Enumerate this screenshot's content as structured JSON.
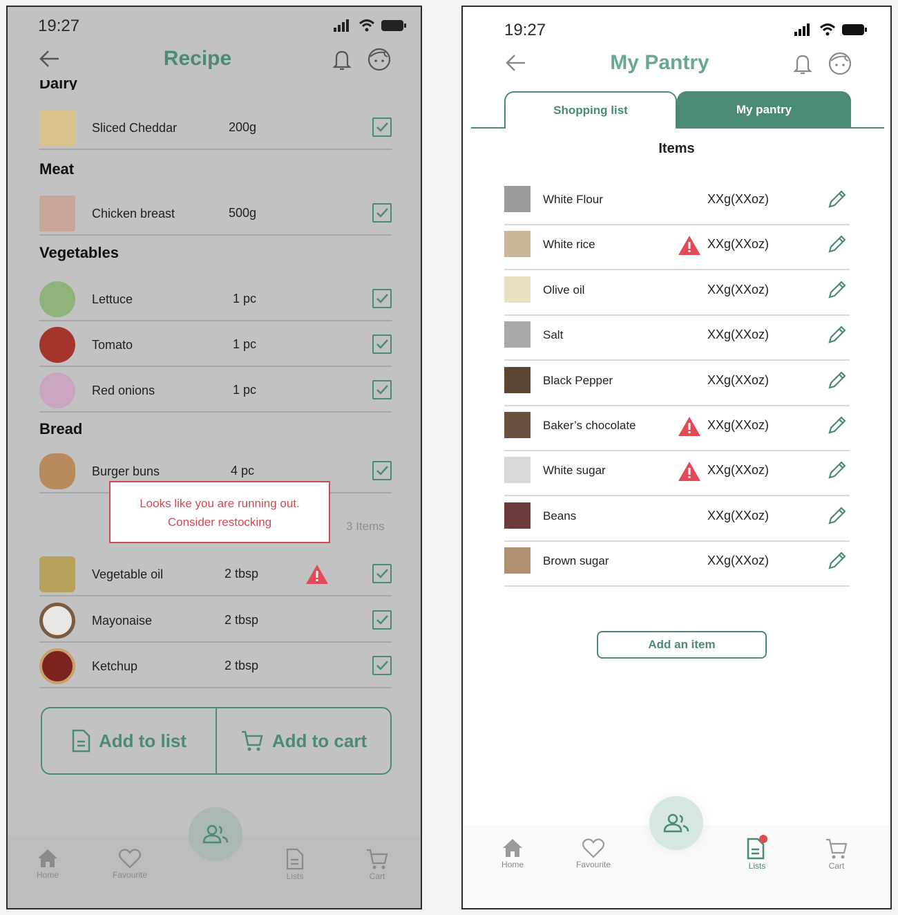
{
  "left": {
    "status": {
      "time": "19:27"
    },
    "header": {
      "title": "Recipe"
    },
    "partial_category": "Dairy",
    "categories": {
      "meat": "Meat",
      "vegetables": "Vegetables",
      "bread": "Bread"
    },
    "ingredients": [
      {
        "name": "Sliced Cheddar",
        "qty": "200g"
      },
      {
        "name": "Chicken breast",
        "qty": "500g"
      },
      {
        "name": "Lettuce",
        "qty": "1 pc"
      },
      {
        "name": "Tomato",
        "qty": "1 pc"
      },
      {
        "name": "Red onions",
        "qty": "1 pc"
      },
      {
        "name": "Burger buns",
        "qty": "4 pc"
      },
      {
        "name": "Vegetable oil",
        "qty": "2 tbsp"
      },
      {
        "name": "Mayonaise",
        "qty": "2 tbsp"
      },
      {
        "name": "Ketchup",
        "qty": "2 tbsp"
      }
    ],
    "tooltip": {
      "line1": "Looks like you are running out.",
      "line2": "Consider restocking"
    },
    "items_count": "3 Items",
    "buttons": {
      "add_to_list": "Add to list",
      "add_to_cart": "Add to cart"
    },
    "nav": {
      "home": "Home",
      "favourite": "Favourite",
      "lists": "Lists",
      "cart": "Cart"
    }
  },
  "right": {
    "status": {
      "time": "19:27"
    },
    "header": {
      "title": "My Pantry"
    },
    "tabs": {
      "shopping": "Shopping list",
      "pantry": "My pantry"
    },
    "items_heading": "Items",
    "items": [
      {
        "name": "White Flour",
        "amount": "XXg(XXoz)",
        "warning": false
      },
      {
        "name": "White rice",
        "amount": "XXg(XXoz)",
        "warning": true
      },
      {
        "name": "Olive oil",
        "amount": "XXg(XXoz)",
        "warning": false
      },
      {
        "name": "Salt",
        "amount": "XXg(XXoz)",
        "warning": false
      },
      {
        "name": "Black Pepper",
        "amount": "XXg(XXoz)",
        "warning": false
      },
      {
        "name": "Baker’s chocolate",
        "amount": "XXg(XXoz)",
        "warning": true
      },
      {
        "name": "White sugar",
        "amount": "XXg(XXoz)",
        "warning": true
      },
      {
        "name": "Beans",
        "amount": "XXg(XXoz)",
        "warning": false
      },
      {
        "name": "Brown sugar",
        "amount": "XXg(XXoz)",
        "warning": false
      }
    ],
    "add_item": "Add an item",
    "nav": {
      "home": "Home",
      "favourite": "Favourite",
      "lists": "Lists",
      "cart": "Cart"
    }
  },
  "colors": {
    "accent": "#4a8a76",
    "warning": "#e24a57",
    "tooltip_text": "#d04a55"
  }
}
